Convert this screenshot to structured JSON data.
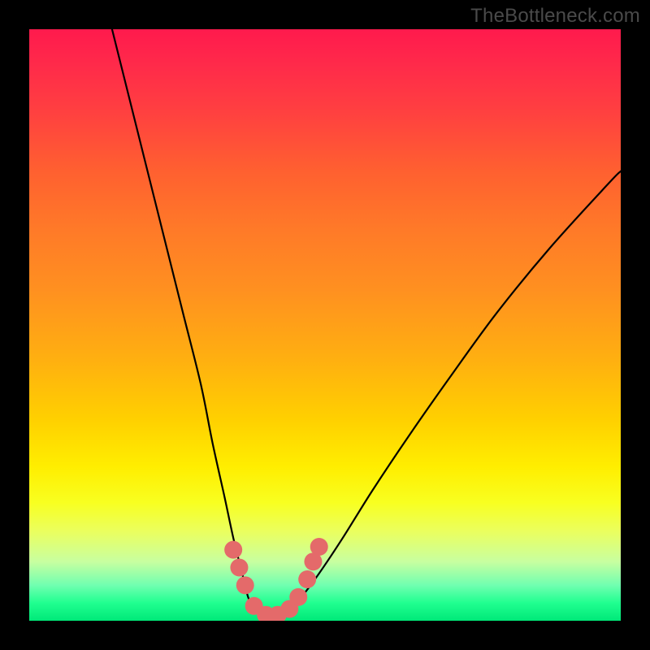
{
  "watermark": {
    "text": "TheBottleneck.com"
  },
  "chart_data": {
    "type": "line",
    "title": "",
    "xlabel": "",
    "ylabel": "",
    "xlim": [
      0,
      100
    ],
    "ylim": [
      0,
      100
    ],
    "curve": {
      "x": [
        14,
        17,
        20,
        23,
        26,
        29,
        31,
        33,
        34.5,
        36,
        37,
        38,
        39,
        40,
        42,
        44,
        46,
        49,
        53,
        58,
        64,
        71,
        79,
        88,
        98,
        100
      ],
      "y": [
        100,
        88,
        76,
        64,
        52,
        40,
        30,
        21,
        14,
        8,
        4,
        2,
        1,
        1,
        1,
        2,
        4,
        8,
        14,
        22,
        31,
        41,
        52,
        63,
        74,
        76
      ]
    },
    "markers": {
      "x": [
        34.5,
        35.5,
        36.5,
        38,
        40,
        42,
        44,
        45.5,
        47,
        48,
        49
      ],
      "y": [
        12,
        9,
        6,
        2.5,
        1,
        1,
        2,
        4,
        7,
        10,
        12.5
      ],
      "radius_px": 11,
      "color": "#e46a6a"
    }
  }
}
